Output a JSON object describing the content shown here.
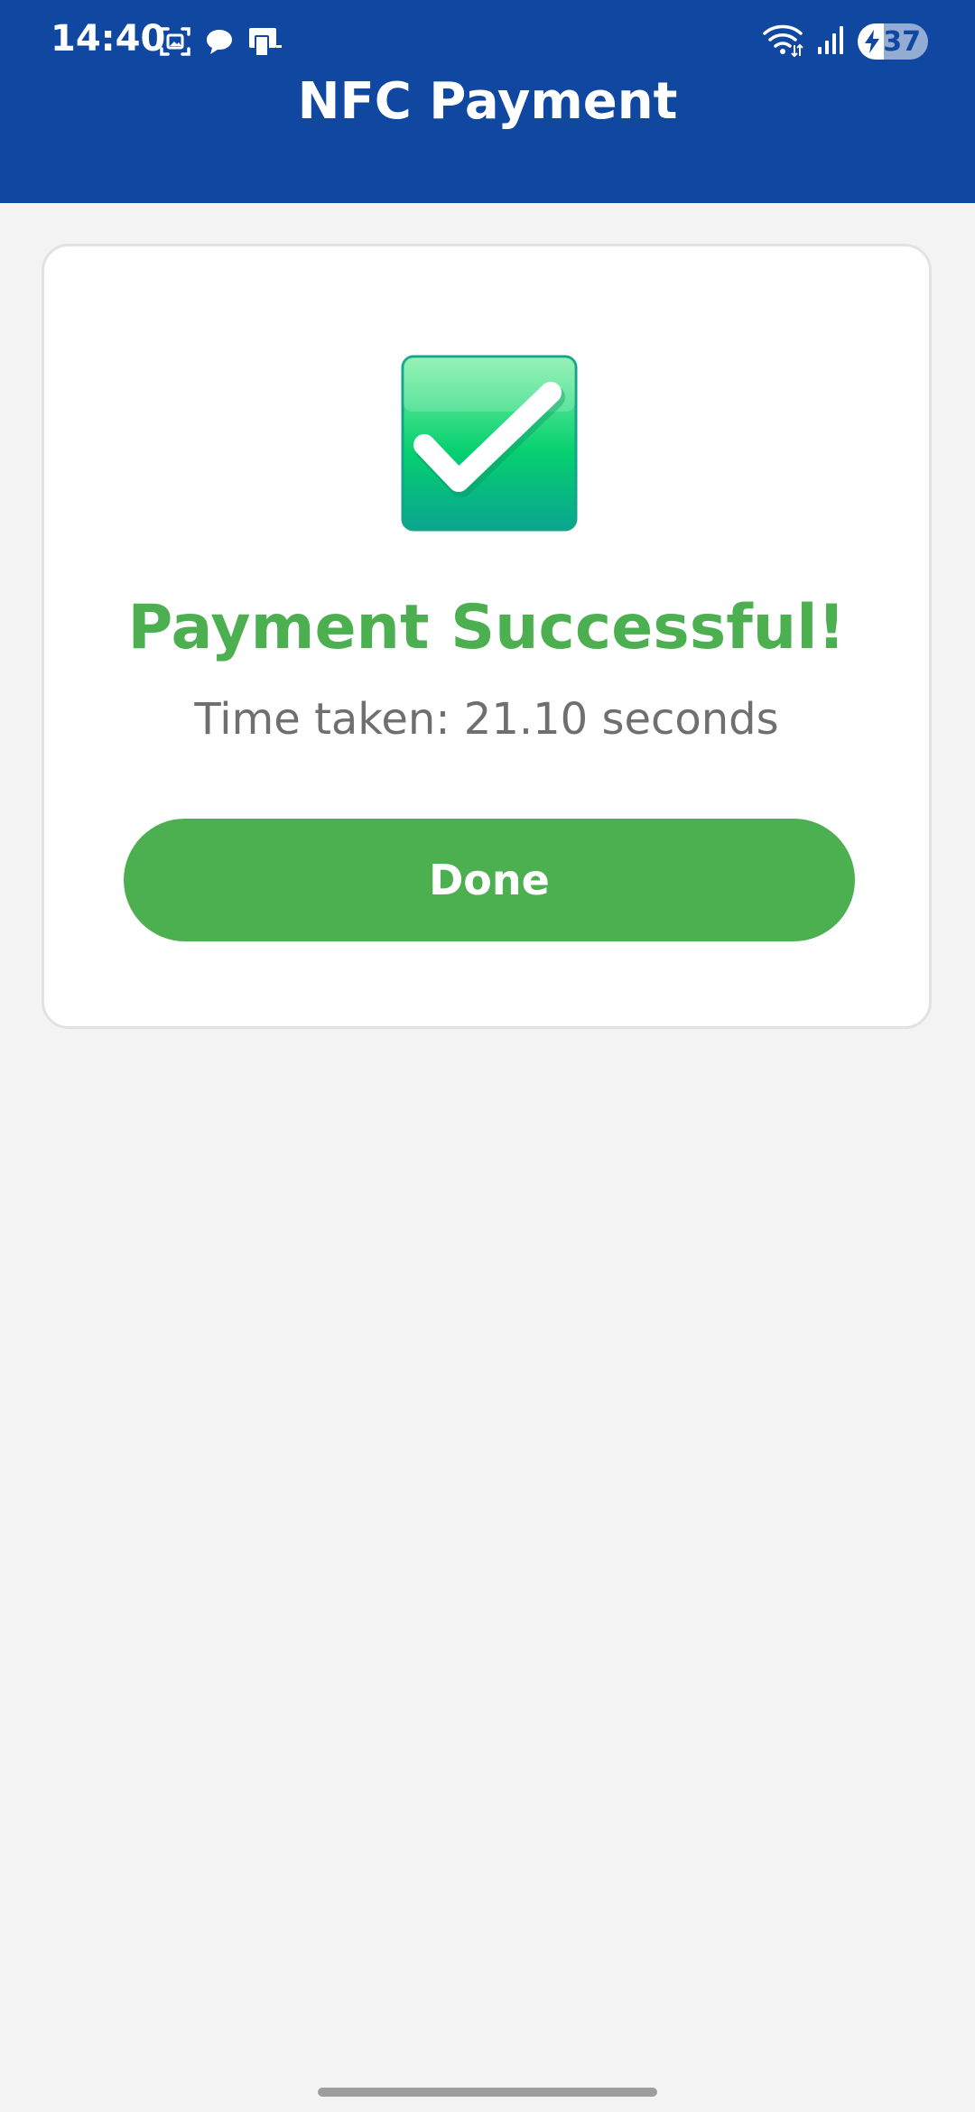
{
  "status_bar": {
    "time": "14:40",
    "left_icons": [
      "screenshot-icon",
      "chat-bubble-icon",
      "nfc-card-icon"
    ],
    "right_icons": [
      "wifi-icon",
      "signal-icon"
    ],
    "battery_level": "37",
    "battery_fraction": 0.37,
    "charging": true
  },
  "app_bar": {
    "title": "NFC Payment",
    "color": "#0f47a1"
  },
  "result_card": {
    "icon": "check-mark-button-icon",
    "title": "Payment Successful!",
    "title_color": "#4caf50",
    "time_taken": "Time taken: 21.10 seconds",
    "done_label": "Done",
    "button_color": "#4caf50"
  }
}
